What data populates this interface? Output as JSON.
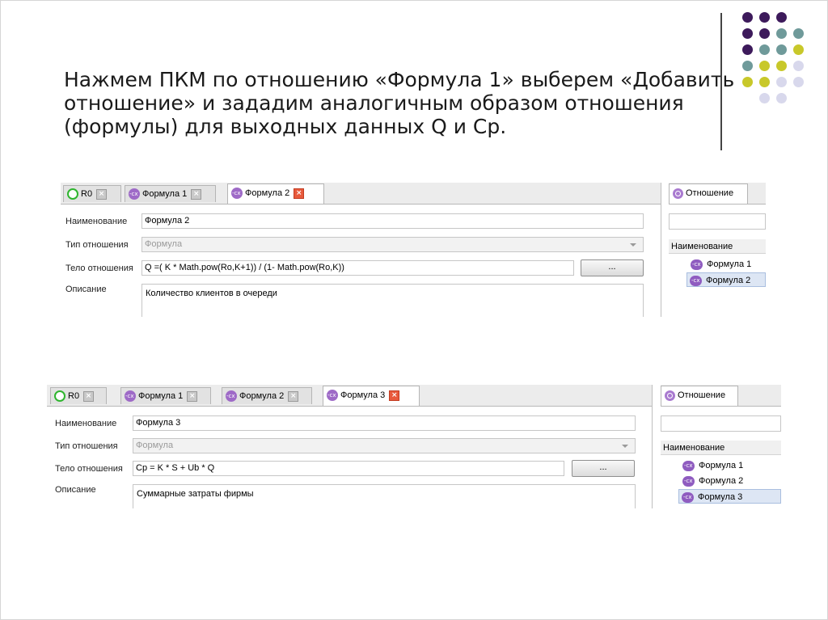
{
  "slide": {
    "title_lines": [
      "Нажмем ПКМ по отношению «Формула 1» выберем «Добавить",
      "отношение» и зададим аналогичным образом отношения",
      "(формулы) для выходных данных Q  и Ср."
    ],
    "colors": {
      "purple": "#3d1a5b",
      "teal": "#6f9a9a",
      "olive": "#c8c82a",
      "lavender": "#d8d8ec"
    }
  },
  "shot1": {
    "tabs": [
      {
        "label": "R0",
        "icon": "green-circle-icon"
      },
      {
        "label": "Формула 1",
        "icon": "formula-icon"
      },
      {
        "label": "Формула 2",
        "icon": "formula-icon",
        "active": true
      }
    ],
    "fields": {
      "name_label": "Наименование",
      "name_value": "Формула 2",
      "type_label": "Тип отношения",
      "type_value": "Формула",
      "body_label": "Тело отношения",
      "body_value": "Q =( K * Math.pow(Ro,K+1)) / (1- Math.pow(Ro,K))",
      "desc_label": "Описание",
      "desc_value": "Количество клиентов в очереди",
      "dots_label": "..."
    },
    "side": {
      "tab_label": "Отношение",
      "header": "Наименование",
      "items": [
        "Формула 1",
        "Формула 2"
      ]
    }
  },
  "shot2": {
    "tabs": [
      {
        "label": "R0",
        "icon": "green-circle-icon"
      },
      {
        "label": "Формула 1",
        "icon": "formula-icon"
      },
      {
        "label": "Формула 2",
        "icon": "formula-icon"
      },
      {
        "label": "Формула 3",
        "icon": "formula-icon",
        "active": true
      }
    ],
    "fields": {
      "name_label": "Наименование",
      "name_value": "Формула 3",
      "type_label": "Тип отношения",
      "type_value": "Формула",
      "body_label": "Тело отношения",
      "body_value": "Cp = K * S + Ub * Q",
      "desc_label": "Описание",
      "desc_value": "Суммарные затраты фирмы",
      "dots_label": "..."
    },
    "side": {
      "tab_label": "Отношение",
      "header": "Наименование",
      "items": [
        "Формула 1",
        "Формула 2",
        "Формула 3"
      ]
    }
  }
}
